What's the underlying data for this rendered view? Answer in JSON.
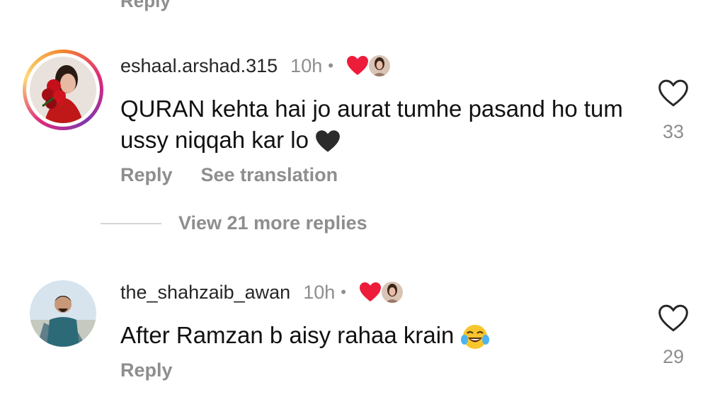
{
  "top_partial": {
    "reply_label": "Reply"
  },
  "comments": [
    {
      "username": "eshaal.arshad.315",
      "time": "10h",
      "text": "QURAN kehta hai jo aurat tumhe pasand ho tum ussy niqqah kar lo",
      "text_emoji": "black-heart",
      "likes": "33",
      "actions": {
        "reply": "Reply",
        "translate": "See translation"
      }
    },
    {
      "username": "the_shahzaib_awan",
      "time": "10h",
      "text": "After Ramzan b aisy rahaa krain",
      "text_emoji": "tears-of-joy",
      "likes": "29",
      "actions": {
        "reply": "Reply"
      }
    }
  ],
  "view_replies": "View 21 more replies",
  "colors": {
    "secondary_text": "#8e8e8e",
    "creator_heart": "#ed1c3a",
    "story_ring": "#dd2a7b"
  }
}
